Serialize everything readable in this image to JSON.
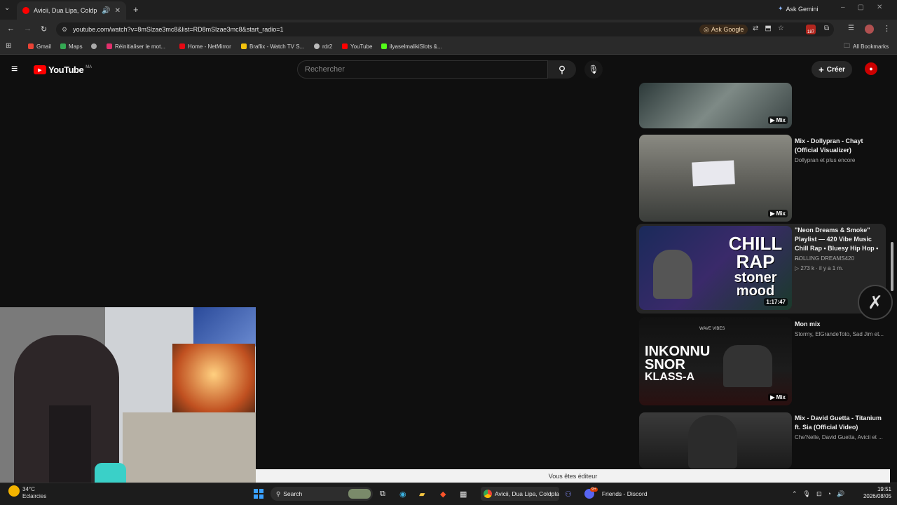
{
  "browser": {
    "tab_title": "Avicii, Dua Lipa, Coldplay, M",
    "url": "youtube.com/watch?v=8mSlzae3mc8&list=RD8mSlzae3mc8&start_radio=1",
    "ask_gemini": "Ask Gemini",
    "ask_google": "Ask Google",
    "extension_badge": "187",
    "all_bookmarks": "All Bookmarks",
    "bookmarks": [
      {
        "label": "Gmail",
        "color": "#ea4335"
      },
      {
        "label": "Maps",
        "color": "#34a853"
      },
      {
        "label": "",
        "color": "#aaaaaa"
      },
      {
        "label": "Réinitialiser le mot...",
        "color": "#e1306c"
      },
      {
        "label": "Home - NetMirror",
        "color": "#e50914"
      },
      {
        "label": "Braflix - Watch TV S...",
        "color": "#f4c20d"
      },
      {
        "label": "rdr2",
        "color": "#bbbbbb"
      },
      {
        "label": "YouTube",
        "color": "#ff0000"
      },
      {
        "label": "ilyaselmalikiSlots &...",
        "color": "#53fc18"
      }
    ]
  },
  "youtube": {
    "logo_text": "YouTube",
    "region": "MA",
    "search_placeholder": "Rechercher",
    "create_label": "Créer",
    "playlist": [
      {
        "title": "",
        "meta1": "",
        "meta2": "",
        "badge": "▶ Mix"
      },
      {
        "title": "Mix - Dollypran - Chayt (Official Visualizer)",
        "meta1": "Dollypran et plus encore",
        "meta2": "",
        "badge": "▶ Mix",
        "thumb_color": "#7a7a72"
      },
      {
        "title": "\"Neon Dreams & Smoke\" Playlist — 420 Vibe Music Chill Rap • Bluesy Hip Hop • ...",
        "meta1": "ROLLING DREAMS420",
        "meta2": "▷ 273 k · il y a 1 m.",
        "badge": "1:17:47",
        "thumb_text": [
          "CHILL",
          "RAP",
          "stoner",
          "mood"
        ]
      },
      {
        "title": "Mon mix",
        "meta1": "Stormy, ElGrandeToto, Sad Jim et...",
        "meta2": "",
        "badge": "▶ Mix",
        "thumb_text": [
          "INKONNU",
          "SNOR",
          "KLASS-A"
        ],
        "thumb_small": "WAVE VIBES"
      },
      {
        "title": "Mix - David Guetta - Titanium ft. Sia (Official Video)",
        "meta1": "Che'Nelle, David Guetta, Avicii et ...",
        "meta2": "",
        "badge": ""
      }
    ]
  },
  "editor_banner": "Vous êtes éditeur",
  "taskbar": {
    "weather_temp": "34°C",
    "weather_label": "Eclaircies",
    "search_label": "Search",
    "chrome_label": "Avicii, Dua Lipa, Coldpla",
    "discord_label": "Friends - Discord",
    "discord_badge": "9+",
    "time": "19:51",
    "date": "2026/08/05"
  }
}
